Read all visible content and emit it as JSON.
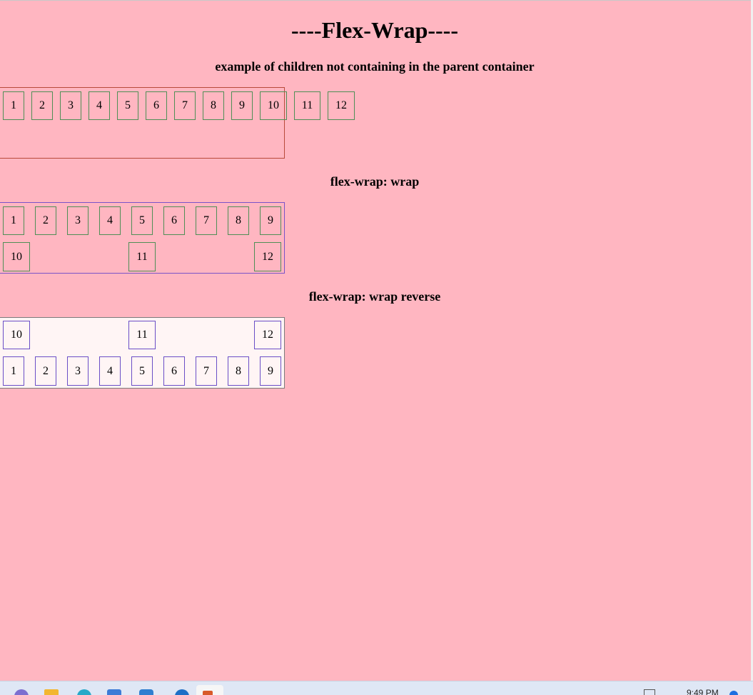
{
  "page": {
    "title": "----Flex-Wrap----",
    "background": "#ffb6c1"
  },
  "sections": [
    {
      "heading": "example of children not containing in the parent container",
      "items": [
        "1",
        "2",
        "3",
        "4",
        "5",
        "6",
        "7",
        "8",
        "9",
        "10",
        "11",
        "12"
      ]
    },
    {
      "heading": "flex-wrap: wrap",
      "row1": [
        "1",
        "2",
        "3",
        "4",
        "5",
        "6",
        "7",
        "8",
        "9"
      ],
      "row2": [
        "10",
        "11",
        "12"
      ]
    },
    {
      "heading": "flex-wrap: wrap reverse",
      "row1": [
        "10",
        "11",
        "12"
      ],
      "row2": [
        "1",
        "2",
        "3",
        "4",
        "5",
        "6",
        "7",
        "8",
        "9"
      ]
    }
  ],
  "colors": {
    "box1_border": "#b84a3a",
    "box2_border": "#7a52c8",
    "box3_background": "#fff5f5",
    "item_green": "#4f8f55",
    "item_purple": "#6a4ec6"
  },
  "taskbar": {
    "icons": [
      "start-icon",
      "file-explorer-icon",
      "edge-browser-icon",
      "store-icon",
      "mail-icon",
      "vscode-icon",
      "active-app-icon"
    ],
    "clock": "9:49 PM"
  }
}
